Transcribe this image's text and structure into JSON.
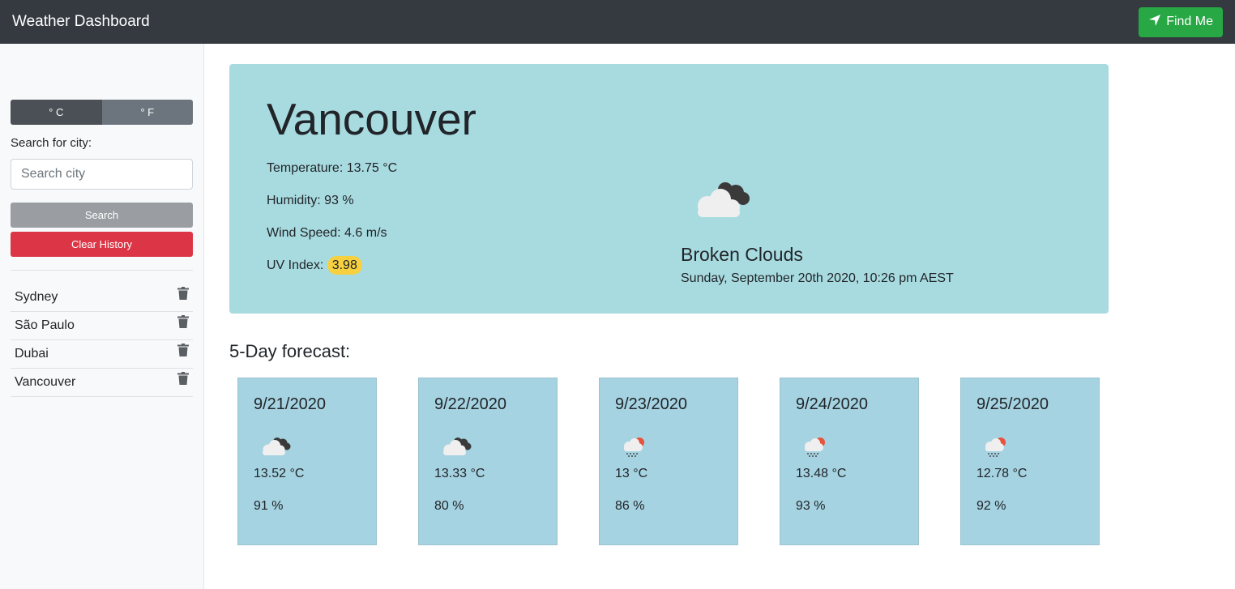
{
  "navbar": {
    "brand": "Weather Dashboard",
    "find_me": "Find Me"
  },
  "sidebar": {
    "unit_c": "° C",
    "unit_f": "° F",
    "search_label": "Search for city:",
    "search_placeholder": "Search city",
    "search_button": "Search",
    "clear_button": "Clear History",
    "history": [
      {
        "city": "Sydney"
      },
      {
        "city": "São Paulo"
      },
      {
        "city": "Dubai"
      },
      {
        "city": "Vancouver"
      }
    ]
  },
  "current": {
    "city": "Vancouver",
    "temperature": "Temperature: 13.75 °C",
    "humidity": "Humidity: 93 %",
    "wind": "Wind Speed: 4.6 m/s",
    "uv_label": "UV Index: ",
    "uv_value": "3.98",
    "description": "Broken Clouds",
    "datetime": "Sunday, September 20th 2020, 10:26 pm AEST",
    "icon": "broken-clouds-icon"
  },
  "forecast": {
    "title": "5-Day forecast:",
    "days": [
      {
        "date": "9/21/2020",
        "temp": "13.52 °C",
        "humidity": "91 %",
        "icon": "broken-clouds-icon"
      },
      {
        "date": "9/22/2020",
        "temp": "13.33 °C",
        "humidity": "80 %",
        "icon": "broken-clouds-icon"
      },
      {
        "date": "9/23/2020",
        "temp": "13 °C",
        "humidity": "86 %",
        "icon": "light-rain-icon"
      },
      {
        "date": "9/24/2020",
        "temp": "13.48 °C",
        "humidity": "93 %",
        "icon": "light-rain-icon"
      },
      {
        "date": "9/25/2020",
        "temp": "12.78 °C",
        "humidity": "92 %",
        "icon": "light-rain-icon"
      }
    ]
  },
  "colors": {
    "navbar": "#343a40",
    "find_me": "#28a745",
    "clear": "#dc3545",
    "main_card": "#a8dbe0",
    "forecast_card": "#a5d3e1",
    "uv_badge": "#f7d040"
  }
}
